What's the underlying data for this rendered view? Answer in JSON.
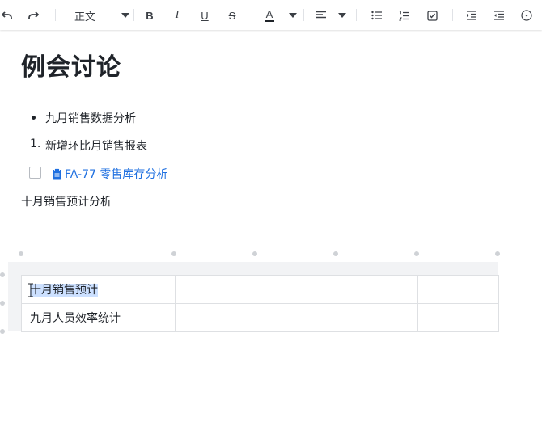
{
  "toolbar": {
    "undo_icon": "undo-icon",
    "redo_icon": "redo-icon",
    "text_style": "正文",
    "bold": "B",
    "italic": "I",
    "underline": "U",
    "strikethrough": "S",
    "font_color_letter": "A",
    "accent_color": "#1e6fe0"
  },
  "document": {
    "title": "例会讨论",
    "bullet_item": "九月销售数据分析",
    "numbered_item_index": "1.",
    "numbered_item": "新增环比月销售报表",
    "task_link": "FA-77 零售库存分析",
    "paragraph": "十月销售预计分析"
  },
  "table": {
    "rows": [
      [
        "十月销售预计",
        "",
        "",
        "",
        ""
      ],
      [
        "九月人员效率统计",
        "",
        "",
        "",
        ""
      ]
    ]
  }
}
